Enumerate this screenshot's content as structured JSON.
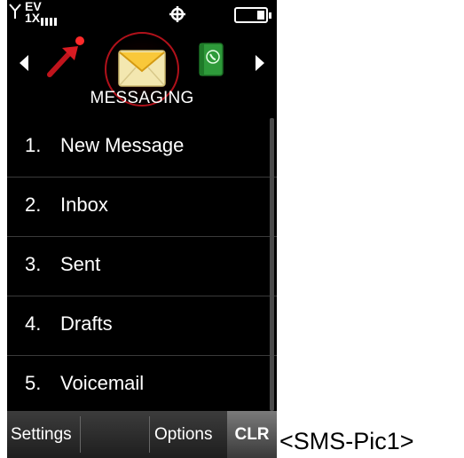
{
  "status_bar": {
    "network_label": "EV\n1X",
    "icons": [
      "signal-antenna-icon",
      "ev-1x-icon",
      "signal-bars-icon",
      "gps-icon",
      "battery-icon"
    ]
  },
  "carousel": {
    "label": "MESSAGING",
    "icons": [
      "arrow-left-icon",
      "pushpin-icon",
      "envelope-icon",
      "phonebook-icon",
      "arrow-right-icon"
    ],
    "accent": "#b0111a"
  },
  "menu": {
    "items": [
      {
        "num": "1.",
        "label": "New Message"
      },
      {
        "num": "2.",
        "label": "Inbox"
      },
      {
        "num": "3.",
        "label": "Sent"
      },
      {
        "num": "4.",
        "label": "Drafts"
      },
      {
        "num": "5.",
        "label": "Voicemail"
      }
    ]
  },
  "softkeys": {
    "left": "Settings",
    "center": "Options",
    "right": "CLR"
  },
  "caption": "<SMS-Pic1>"
}
